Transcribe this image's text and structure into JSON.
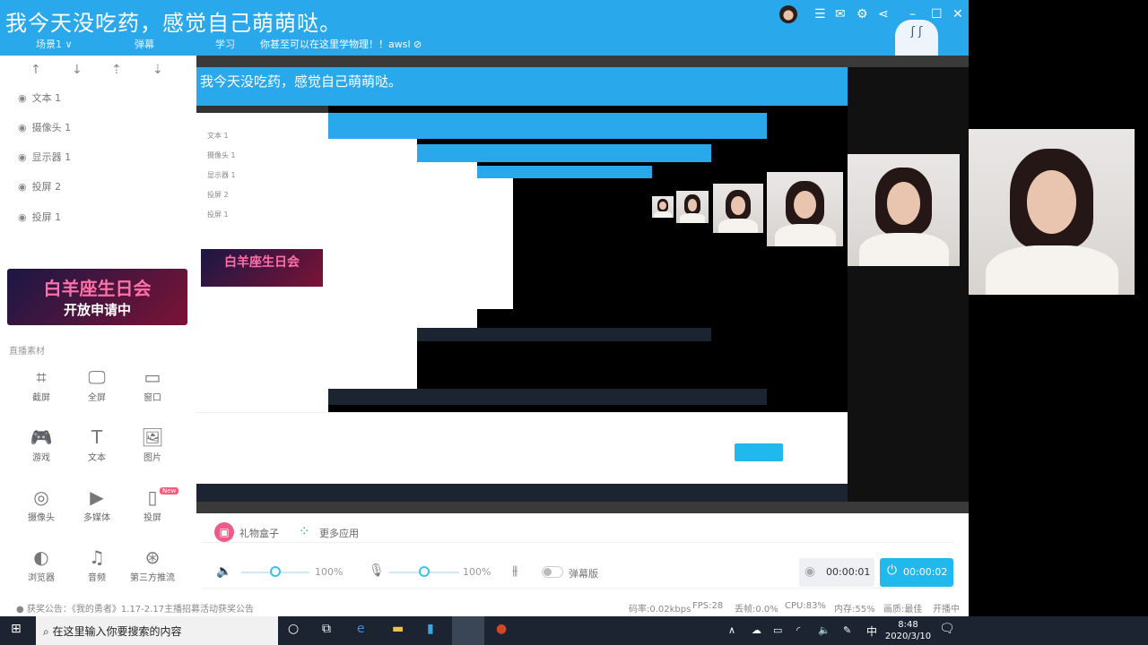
{
  "header": {
    "title": "我今天没吃药，感觉自己萌萌哒。",
    "tabs": [
      "场景1 ∨",
      "弹幕",
      "学习"
    ],
    "notice": "你甚至可以在这里学物理！！awsl ⊘",
    "icons": [
      "avatar",
      "menu-icon",
      "mail-icon",
      "gear-icon",
      "share-icon",
      "minimize-icon",
      "maximize-icon",
      "close-icon"
    ]
  },
  "sidebar": {
    "arrows": [
      "↑",
      "↓",
      "⇡",
      "⇣"
    ],
    "layers": [
      "文本 1",
      "摄像头 1",
      "显示器 1",
      "投屏 2",
      "投屏 1"
    ],
    "banner": {
      "line1": "白羊座生日会",
      "line2": "开放申请中"
    },
    "materials_label": "直播素材",
    "materials": [
      {
        "icon": "⌗",
        "label": "截屏"
      },
      {
        "icon": "🖵",
        "label": "全屏"
      },
      {
        "icon": "▭",
        "label": "窗口"
      },
      {
        "icon": "🎮",
        "label": "游戏"
      },
      {
        "icon": "T",
        "label": "文本"
      },
      {
        "icon": "🖼",
        "label": "图片"
      },
      {
        "icon": "◎",
        "label": "摄像头"
      },
      {
        "icon": "▶",
        "label": "多媒体"
      },
      {
        "icon": "▯",
        "label": "投屏"
      },
      {
        "icon": "◐",
        "label": "浏览器"
      },
      {
        "icon": "♫",
        "label": "音频"
      },
      {
        "icon": "⊛",
        "label": "第三方推流"
      }
    ],
    "new_badge": "New"
  },
  "bottom": {
    "gift": "礼物盒子",
    "more_apps": "更多应用",
    "speaker_volume": "100%",
    "mic_volume": "100%",
    "speaker_level": 0.5,
    "mic_level": 0.5,
    "danmu": "弹幕版",
    "record_time": "00:00:01",
    "live_time": "00:00:02"
  },
  "status": {
    "announcement": "获奖公告：《我的勇者》1.17-2.17主播招募活动获奖公告",
    "bitrate": "码率:0.02kbps",
    "fps": "FPS:28",
    "loss": "丢帧:0.0%",
    "cpu": "CPU:83%",
    "mem": "内存:55%",
    "quality": "画质:最佳",
    "state": "开播中"
  },
  "taskbar": {
    "search_placeholder": "在这里输入你要搜索的内容",
    "ime": "中",
    "time": "8:48",
    "date": "2020/3/10"
  },
  "colors": {
    "accent": "#2aa8ec",
    "live": "#21b8ee"
  }
}
